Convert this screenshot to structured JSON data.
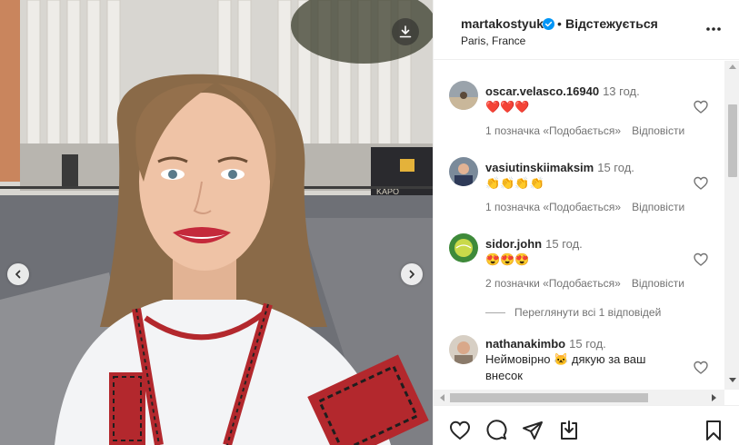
{
  "post": {
    "username": "martakostyuk",
    "follow_label": "Відстежується",
    "location": "Paris, France",
    "separator": "•"
  },
  "photo": {
    "graffiti_text": "KAPO"
  },
  "comments": [
    {
      "username": "oscar.velasco.16940",
      "time": "13 год.",
      "text": "❤️❤️❤️",
      "likes": "1 позначка «Подобається»",
      "reply": "Відповісти"
    },
    {
      "username": "vasiutinskiimaksim",
      "time": "15 год.",
      "text": "👏👏👏👏",
      "likes": "1 позначка «Подобається»",
      "reply": "Відповісти"
    },
    {
      "username": "sidor.john",
      "time": "15 год.",
      "text": "😍😍😍",
      "likes": "2 позначки «Подобається»",
      "reply": "Відповісти"
    },
    {
      "username": "nathanakimbo",
      "time": "15 год.",
      "text": "Неймовірно 🐱 дякую за ваш внесок",
      "likes": "",
      "reply": ""
    }
  ],
  "view_replies_label": "Переглянути всі 1 відповідей",
  "colors": {
    "accent_blue": "#0095f6",
    "text_primary": "#262626",
    "text_secondary": "#737373",
    "heart_red": "#e0245e"
  },
  "icons": [
    "download-icon",
    "chevron-left-icon",
    "chevron-right-icon",
    "verified-icon",
    "more-icon",
    "heart-icon",
    "comment-icon",
    "share-icon",
    "save-icon"
  ]
}
